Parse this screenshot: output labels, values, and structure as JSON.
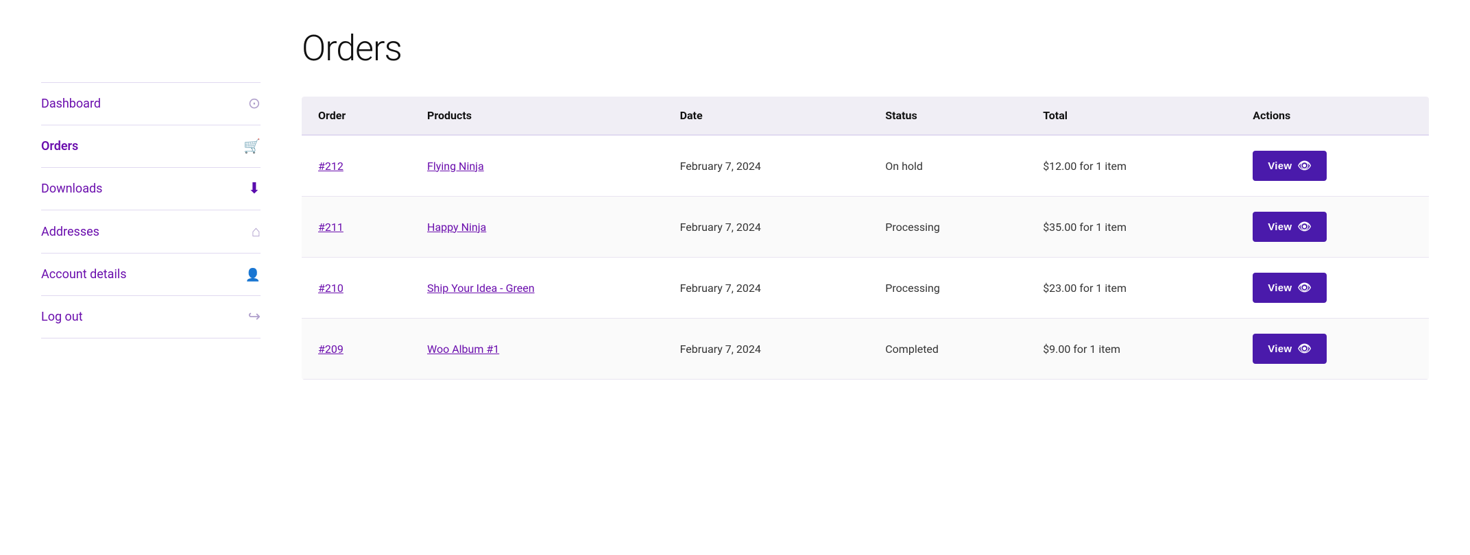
{
  "page": {
    "title": "Orders"
  },
  "sidebar": {
    "items": [
      {
        "id": "dashboard",
        "label": "Dashboard",
        "icon": "dashboard",
        "active": false
      },
      {
        "id": "orders",
        "label": "Orders",
        "icon": "orders",
        "active": true
      },
      {
        "id": "downloads",
        "label": "Downloads",
        "icon": "downloads",
        "active": false
      },
      {
        "id": "addresses",
        "label": "Addresses",
        "icon": "addresses",
        "active": false
      },
      {
        "id": "account-details",
        "label": "Account details",
        "icon": "account",
        "active": false
      },
      {
        "id": "log-out",
        "label": "Log out",
        "icon": "logout",
        "active": false
      }
    ]
  },
  "table": {
    "columns": [
      "Order",
      "Products",
      "Date",
      "Status",
      "Total",
      "Actions"
    ],
    "rows": [
      {
        "order": "#212",
        "product": "Flying Ninja",
        "date": "February 7, 2024",
        "status": "On hold",
        "total": "$12.00 for 1 item",
        "action": "View"
      },
      {
        "order": "#211",
        "product": "Happy Ninja",
        "date": "February 7, 2024",
        "status": "Processing",
        "total": "$35.00 for 1 item",
        "action": "View"
      },
      {
        "order": "#210",
        "product": "Ship Your Idea - Green",
        "date": "February 7, 2024",
        "status": "Processing",
        "total": "$23.00 for 1 item",
        "action": "View"
      },
      {
        "order": "#209",
        "product": "Woo Album #1",
        "date": "February 7, 2024",
        "status": "Completed",
        "total": "$9.00 for 1 item",
        "action": "View"
      }
    ]
  },
  "colors": {
    "accent": "#6a0dad",
    "button": "#4a1aab"
  }
}
